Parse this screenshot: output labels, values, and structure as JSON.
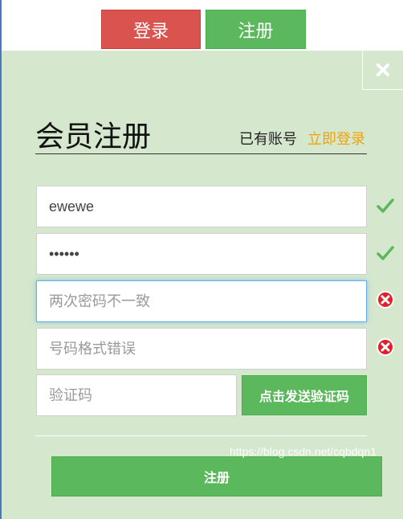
{
  "top_tabs": {
    "login_label": "登录",
    "register_label": "注册"
  },
  "modal": {
    "title": "会员注册",
    "has_account_text": "已有账号",
    "login_link": "立即登录",
    "fields": {
      "username_value": "ewewe",
      "password_value": "••••••",
      "confirm_password_placeholder": "两次密码不一致",
      "phone_placeholder": "号码格式错误",
      "verification_code_placeholder": "验证码"
    },
    "statuses": {
      "username": "check-icon",
      "password": "check-icon",
      "confirm_password": "error-icon",
      "phone": "error-icon"
    },
    "send_code_label": "点击发送验证码",
    "submit_label": "注册",
    "close_icon": "close-icon"
  },
  "watermark": "https://blog.csdn.net/cqbdqn1",
  "colors": {
    "modal_bg": "#d5e8cd",
    "login_tab": "#d9534f",
    "success_green": "#5cb85c",
    "link_orange": "#f0a30a",
    "error_red": "#e0202a"
  }
}
